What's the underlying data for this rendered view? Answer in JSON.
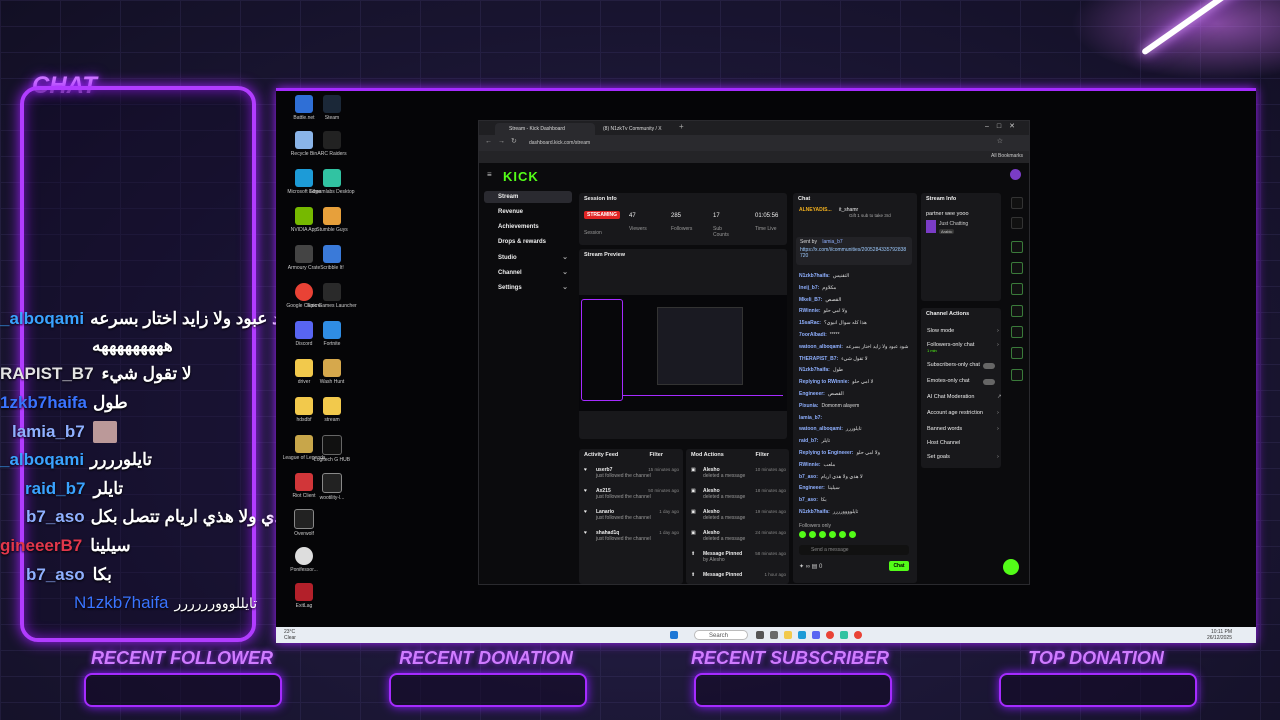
{
  "overlay": {
    "chat_title": "CHAT",
    "chat_messages": [
      {
        "user": "_alboqami",
        "user_color": "#3aa3ff",
        "text": "شود عبود ولا زايد اختار بسرعه"
      },
      {
        "user": "",
        "user_color": "#ffffff",
        "text": "هههههههههه"
      },
      {
        "user": "RAPIST_B7",
        "user_color": "#e3e3e3",
        "text": "لا تقول شيء"
      },
      {
        "user": "1zkb7haifa",
        "user_color": "#3a74ff",
        "text": "طول"
      },
      {
        "user": "lamia_b7",
        "user_color": "#8fb0ff",
        "text": ""
      },
      {
        "user": "_alboqami",
        "user_color": "#3aa3ff",
        "text": "تايلورررر"
      },
      {
        "user": "raid_b7",
        "user_color": "#3aa3ff",
        "text": "تايلر"
      },
      {
        "user": "b7_aso",
        "user_color": "#8fb0ff",
        "text": "لا هذي ولا هذي اريام تتصل بكل"
      },
      {
        "user": "gineeerB7",
        "user_color": "#e2374b",
        "text": "سيلينا"
      },
      {
        "user": "b7_aso",
        "user_color": "#8fb0ff",
        "text": "بكا"
      },
      {
        "user": "N1zkb7haifa",
        "user_color": "#3a74ff",
        "text": "تايللووورررررر"
      }
    ],
    "bottom_widgets": [
      "RECENT FOLLOWER",
      "RECENT DONATION",
      "RECENT SUBSCRIBER",
      "TOP DONATION"
    ],
    "accent": "#a52bff"
  },
  "desktop": {
    "icons": [
      "Battle.net",
      "Steam",
      "Recycle Bin",
      "ARC Raiders",
      "Microsoft Edge",
      "Streamlabs Desktop",
      "NVIDIA App",
      "Stumble Guys",
      "Armoury Crate",
      "Scribble It!",
      "Google Chrome",
      "Epic Games Launcher",
      "Discord",
      "Fortnite",
      "driver",
      "Wash Hunt",
      "hdsdbf",
      "stream",
      "League of Legends",
      "Logitech G HUB",
      "Riot Client",
      "wootility-l...",
      "Overwolf",
      "Ponifessor...",
      "ExitLag"
    ],
    "taskbar": {
      "weather_temp": "23°C",
      "weather_desc": "Clear",
      "search_placeholder": "Search",
      "time": "10:11 PM",
      "date": "26/12/2025"
    }
  },
  "browser": {
    "tabs": [
      "Stream - Kick Dashboard",
      "(8) N1zkTv Community / X"
    ],
    "url": "dashboard.kick.com/stream",
    "bookmarks_label": "All Bookmarks"
  },
  "kick": {
    "logo": "KICK",
    "sidebar": [
      {
        "label": "Stream",
        "active": true,
        "chevron": false
      },
      {
        "label": "Revenue",
        "active": false,
        "chevron": false
      },
      {
        "label": "Achievements",
        "active": false,
        "chevron": false
      },
      {
        "label": "Drops & rewards",
        "active": false,
        "chevron": false
      },
      {
        "label": "Studio",
        "active": false,
        "chevron": true
      },
      {
        "label": "Channel",
        "active": false,
        "chevron": true
      },
      {
        "label": "Settings",
        "active": false,
        "chevron": true
      }
    ],
    "session_info": {
      "title": "Session Info",
      "badge": "STREAMING",
      "stats": [
        {
          "value": "",
          "label": "Session"
        },
        {
          "value": "47",
          "label": "Viewers"
        },
        {
          "value": "285",
          "label": "Followers"
        },
        {
          "value": "17",
          "label": "Sub Counts"
        },
        {
          "value": "01:05:56",
          "label": "Time Live"
        }
      ]
    },
    "stream_preview_title": "Stream Preview",
    "activity_feed": {
      "title": "Activity Feed",
      "filter": "Filter",
      "items": [
        {
          "name": "userb7",
          "sub": "just followed the channel",
          "time": "15 minutes ago"
        },
        {
          "name": "Ax215",
          "sub": "just followed the channel",
          "time": "50 minutes ago"
        },
        {
          "name": "Lanario",
          "sub": "just followed the channel",
          "time": "1 day ago"
        },
        {
          "name": "shahad1q",
          "sub": "just followed the channel",
          "time": "1 day ago"
        }
      ]
    },
    "mod_actions": {
      "title": "Mod Actions",
      "filter": "Filter",
      "items": [
        {
          "name": "Alesho",
          "sub": "deleted a message",
          "time": "10 minutes ago"
        },
        {
          "name": "Alesho",
          "sub": "deleted a message",
          "time": "18 minutes ago"
        },
        {
          "name": "Alesho",
          "sub": "deleted a message",
          "time": "19 minutes ago"
        },
        {
          "name": "Alesho",
          "sub": "deleted a message",
          "time": "24 minutes ago"
        },
        {
          "name": "Message Pinned",
          "sub": "by Alesho",
          "time": "58 minutes ago"
        },
        {
          "name": "Message Pinned",
          "sub": "",
          "time": "1 hour ago"
        }
      ]
    },
    "chat": {
      "title": "Chat",
      "pinned_user": "ALNEYADIS...",
      "pinned_user2": "it_shamr",
      "pinned_note": "Gift 1 sub to take 3rd",
      "sent_by_label": "Sent by",
      "sent_by_user": "lamia_b7",
      "pinned_link": "https://x.com/i/communities/2005284335792838720",
      "messages": [
        {
          "user": "N1zkb7haifa:",
          "text": "التقنيس"
        },
        {
          "user": "Ineij_b7:",
          "text": "مكلاوم"
        },
        {
          "user": "Mkeli_B7:",
          "text": "القصص"
        },
        {
          "user": "RWinnie:",
          "text": "ولا امي حلو"
        },
        {
          "user": "15saRac:",
          "text": "هذا كله سوال انبوي؟"
        },
        {
          "user": "7oorAlbadi:",
          "text": "*****"
        },
        {
          "user": "watoon_alboqami:",
          "text": "شود عبود ولا زايد اختار بسرعه"
        },
        {
          "user": "THERAPIST_B7:",
          "text": "لا تقول شيء"
        },
        {
          "user": "N1zkb7haifa:",
          "text": "طول"
        },
        {
          "user": "Replying to RWinnie:",
          "text": "لا امي حلو"
        },
        {
          "user": "Engineeer:",
          "text": "القصص"
        },
        {
          "user": "Pixunia:",
          "text": "Domonm alayem"
        },
        {
          "user": "lamia_b7:",
          "text": ""
        },
        {
          "user": "watoon_alboqami:",
          "text": "تايلوررر"
        },
        {
          "user": "raid_b7:",
          "text": "تايلر"
        },
        {
          "user": "Replying to Engineeer:",
          "text": "ولا امي حلو"
        },
        {
          "user": "RWinnie:",
          "text": "ملعب"
        },
        {
          "user": "b7_aso:",
          "text": "لا هذي ولا هذي اريام"
        },
        {
          "user": "Engineeer:",
          "text": "سيلينا"
        },
        {
          "user": "b7_aso:",
          "text": "بكا"
        },
        {
          "user": "N1zkb7haifa:",
          "text": "تايلوووورررر"
        }
      ],
      "followers_only": "Followers only",
      "input_placeholder": "Send a message",
      "count": "0",
      "send_label": "Chat"
    },
    "stream_info": {
      "title": "Stream Info",
      "stream_title": "partner wee yooo",
      "category": "Just Chatting",
      "language": "Arabic"
    },
    "channel_actions": {
      "title": "Channel Actions",
      "items": [
        {
          "label": "Slow mode",
          "sub": "",
          "control": "arrow"
        },
        {
          "label": "Followers-only chat",
          "sub": "1 min",
          "control": "arrow"
        },
        {
          "label": "Subscribers-only chat",
          "sub": "",
          "control": "toggle"
        },
        {
          "label": "Emotes-only chat",
          "sub": "",
          "control": "toggle"
        },
        {
          "label": "AI Chat Moderation",
          "sub": "",
          "control": "external"
        },
        {
          "label": "Account age restriction",
          "sub": "",
          "control": "arrow"
        },
        {
          "label": "Banned words",
          "sub": "",
          "control": "arrow"
        },
        {
          "label": "Host Channel",
          "sub": "",
          "control": "none"
        },
        {
          "label": "Set goals",
          "sub": "",
          "control": "arrow"
        }
      ]
    },
    "brand_green": "#53fc18"
  }
}
